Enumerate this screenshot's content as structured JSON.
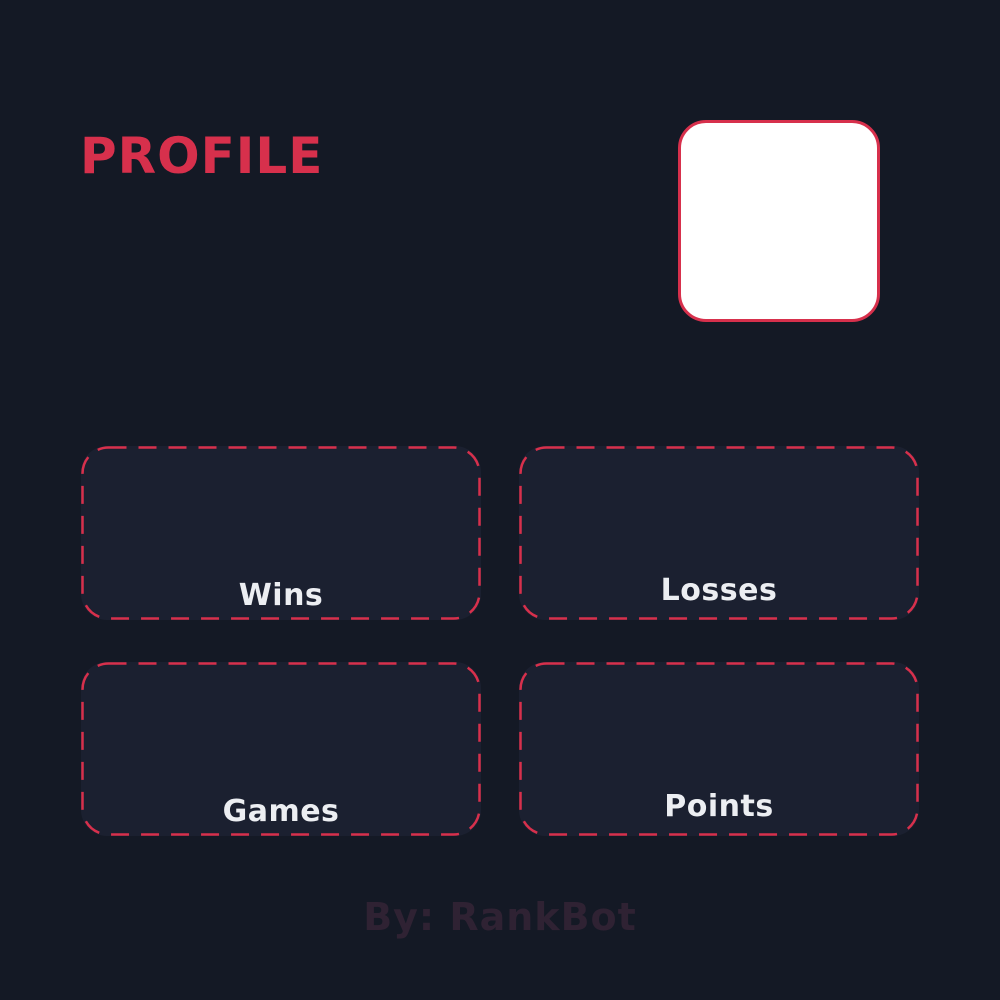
{
  "profile": {
    "title": "PROFILE",
    "accent_color": "#d7304c"
  },
  "stats": [
    {
      "label": "Wins"
    },
    {
      "label": "Losses"
    },
    {
      "label": "Games"
    },
    {
      "label": "Points"
    }
  ],
  "footer": {
    "credit": "By: RankBot"
  }
}
